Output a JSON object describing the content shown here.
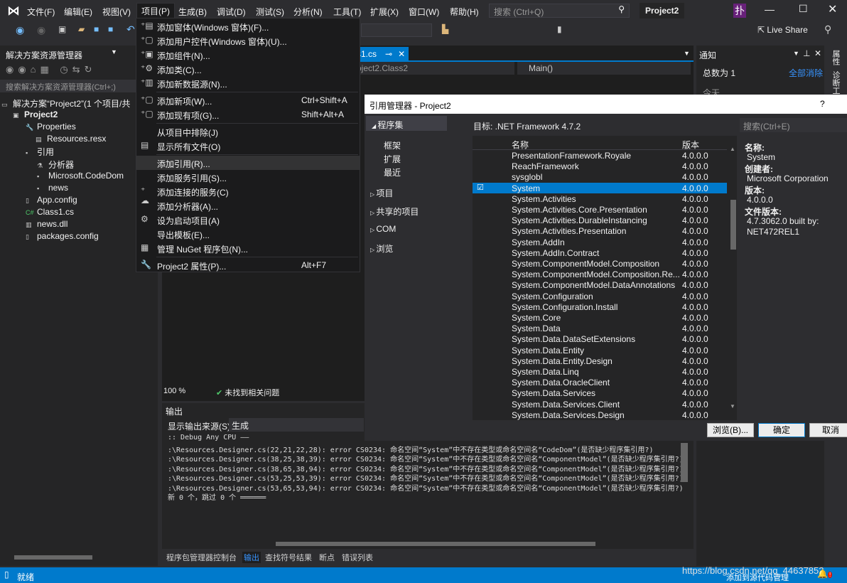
{
  "menubar": {
    "items": [
      "文件(F)",
      "编辑(E)",
      "视图(V)",
      "项目(P)",
      "生成(B)",
      "调试(D)",
      "测试(S)",
      "分析(N)",
      "工具(T)",
      "扩展(X)",
      "窗口(W)",
      "帮助(H)"
    ],
    "search_placeholder": "搜索 (Ctrl+Q)",
    "project_title": "Project2",
    "avatar": "扑",
    "live_share": "Live Share"
  },
  "solution_explorer": {
    "title": "解决方案资源管理器",
    "search_placeholder": "搜索解决方案资源管理器(Ctrl+;)",
    "tree": [
      "解决方案“Project2”(1 个项目/共",
      "Project2",
      "Properties",
      "Resources.resx",
      "引用",
      "分析器",
      "Microsoft.CodeDom",
      "news",
      "App.config",
      "Class1.cs",
      "news.dll",
      "packages.config"
    ]
  },
  "editor": {
    "tab": "ss1.cs",
    "nav_left": "roject2.Class2",
    "nav_right": "Main()",
    "zoom": "100 %",
    "issues": "未找到相关问题"
  },
  "project_menu": {
    "items": [
      {
        "label": "添加窗体(Windows 窗体)(F)...",
        "shortcut": "",
        "icon": "add-form"
      },
      {
        "label": "添加用户控件(Windows 窗体)(U)...",
        "shortcut": "",
        "icon": "add-control"
      },
      {
        "label": "添加组件(N)...",
        "shortcut": "",
        "icon": "add-component"
      },
      {
        "label": "添加类(C)...",
        "shortcut": "",
        "icon": "add-class"
      },
      {
        "label": "添加新数据源(N)...",
        "shortcut": "",
        "icon": "add-datasource"
      },
      {
        "label": "添加新项(W)...",
        "shortcut": "Ctrl+Shift+A",
        "icon": "add-new-item"
      },
      {
        "label": "添加现有项(G)...",
        "shortcut": "Shift+Alt+A",
        "icon": "add-existing-item"
      },
      {
        "label": "从项目中排除(J)",
        "shortcut": "",
        "icon": ""
      },
      {
        "label": "显示所有文件(O)",
        "shortcut": "",
        "icon": "show-all-files"
      },
      {
        "label": "添加引用(R)...",
        "shortcut": "",
        "icon": ""
      },
      {
        "label": "添加服务引用(S)...",
        "shortcut": "",
        "icon": ""
      },
      {
        "label": "添加连接的服务(C)",
        "shortcut": "",
        "icon": "connected-service"
      },
      {
        "label": "添加分析器(A)...",
        "shortcut": "",
        "icon": ""
      },
      {
        "label": "设为启动项目(A)",
        "shortcut": "",
        "icon": "gear"
      },
      {
        "label": "导出模板(E)...",
        "shortcut": "",
        "icon": ""
      },
      {
        "label": "管理 NuGet 程序包(N)...",
        "shortcut": "",
        "icon": "nuget"
      },
      {
        "label": "Project2 属性(P)...",
        "shortcut": "Alt+F7",
        "icon": "wrench"
      }
    ],
    "highlighted": "添加引用(R)..."
  },
  "ref_manager": {
    "title": "引用管理器 - Project2",
    "help": "?",
    "target": "目标: .NET Framework 4.7.2",
    "search_placeholder": "搜索(Ctrl+E)",
    "nav": {
      "assemblies": "程序集",
      "sub": [
        "框架",
        "扩展",
        "最近"
      ],
      "groups": [
        "项目",
        "共享的项目",
        "COM",
        "浏览"
      ]
    },
    "columns": [
      "名称",
      "版本"
    ],
    "rows": [
      {
        "name": "PresentationFramework.Royale",
        "version": "4.0.0.0",
        "checked": false
      },
      {
        "name": "ReachFramework",
        "version": "4.0.0.0",
        "checked": false
      },
      {
        "name": "sysglobl",
        "version": "4.0.0.0",
        "checked": false
      },
      {
        "name": "System",
        "version": "4.0.0.0",
        "checked": true
      },
      {
        "name": "System.Activities",
        "version": "4.0.0.0",
        "checked": false
      },
      {
        "name": "System.Activities.Core.Presentation",
        "version": "4.0.0.0",
        "checked": false
      },
      {
        "name": "System.Activities.DurableInstancing",
        "version": "4.0.0.0",
        "checked": false
      },
      {
        "name": "System.Activities.Presentation",
        "version": "4.0.0.0",
        "checked": false
      },
      {
        "name": "System.AddIn",
        "version": "4.0.0.0",
        "checked": false
      },
      {
        "name": "System.AddIn.Contract",
        "version": "4.0.0.0",
        "checked": false
      },
      {
        "name": "System.ComponentModel.Composition",
        "version": "4.0.0.0",
        "checked": false
      },
      {
        "name": "System.ComponentModel.Composition.Re...",
        "version": "4.0.0.0",
        "checked": false
      },
      {
        "name": "System.ComponentModel.DataAnnotations",
        "version": "4.0.0.0",
        "checked": false
      },
      {
        "name": "System.Configuration",
        "version": "4.0.0.0",
        "checked": false
      },
      {
        "name": "System.Configuration.Install",
        "version": "4.0.0.0",
        "checked": false
      },
      {
        "name": "System.Core",
        "version": "4.0.0.0",
        "checked": false
      },
      {
        "name": "System.Data",
        "version": "4.0.0.0",
        "checked": false
      },
      {
        "name": "System.Data.DataSetExtensions",
        "version": "4.0.0.0",
        "checked": false
      },
      {
        "name": "System.Data.Entity",
        "version": "4.0.0.0",
        "checked": false
      },
      {
        "name": "System.Data.Entity.Design",
        "version": "4.0.0.0",
        "checked": false
      },
      {
        "name": "System.Data.Linq",
        "version": "4.0.0.0",
        "checked": false
      },
      {
        "name": "System.Data.OracleClient",
        "version": "4.0.0.0",
        "checked": false
      },
      {
        "name": "System.Data.Services",
        "version": "4.0.0.0",
        "checked": false
      },
      {
        "name": "System.Data.Services.Client",
        "version": "4.0.0.0",
        "checked": false
      },
      {
        "name": "System.Data.Services.Design",
        "version": "4.0.0.0",
        "checked": false
      }
    ],
    "selected": "System",
    "details": [
      {
        "k": "名称:",
        "v": "System"
      },
      {
        "k": "创建者:",
        "v": "Microsoft Corporation"
      },
      {
        "k": "版本:",
        "v": "4.0.0.0"
      },
      {
        "k": "文件版本:",
        "v": "4.7.3062.0 built by: NET472REL1"
      }
    ],
    "buttons": {
      "browse": "浏览(B)...",
      "ok": "确定",
      "cancel": "取消"
    }
  },
  "output": {
    "title": "输出",
    "source_label": "显示输出来源(S):",
    "source_value": "生成",
    "lines": [
      ":: Debug Any CPU ——",
      ":\\Resources.Designer.cs(22,21,22,28): error CS0234: 命名空间“System”中不存在类型或命名空间名“CodeDom”(是否缺少程序集引用?)",
      ":\\Resources.Designer.cs(38,25,38,39): error CS0234: 命名空间“System”中不存在类型或命名空间名“ComponentModel”(是否缺少程序集引用?)",
      ":\\Resources.Designer.cs(38,65,38,94): error CS0234: 命名空间“System”中不存在类型或命名空间名“ComponentModel”(是否缺少程序集引用?)",
      ":\\Resources.Designer.cs(53,25,53,39): error CS0234: 命名空间“System”中不存在类型或命名空间名“ComponentModel”(是否缺少程序集引用?)",
      ":\\Resources.Designer.cs(53,65,53,94): error CS0234: 命名空间“System”中不存在类型或命名空间名“ComponentModel”(是否缺少程序集引用?)",
      "新 0 个，跳过 0 个 ══════"
    ]
  },
  "bottom_tabs": [
    "程序包管理器控制台",
    "输出",
    "查找符号结果",
    "断点",
    "错误列表"
  ],
  "notifications": {
    "title": "通知",
    "total": "总数为 1",
    "clear_all": "全部消除",
    "today": "今天"
  },
  "side_tabs": [
    "属性",
    "诊断工具"
  ],
  "status": {
    "text": "就绪",
    "source_control": "添加到源代码管理",
    "watermark": "https://blog.csdn.net/qq_44637852"
  },
  "colors": {
    "accent": "#007acc",
    "background": "#2d2d30",
    "menu_bg": "#1b1b1c"
  }
}
